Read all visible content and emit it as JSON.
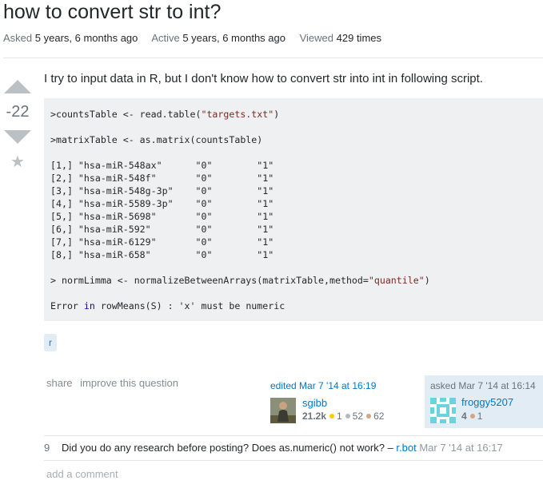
{
  "question": {
    "title": "how to convert str to int?",
    "meta": {
      "asked_label": "Asked",
      "asked_value": "5 years, 6 months ago",
      "active_label": "Active",
      "active_value": "5 years, 6 months ago",
      "viewed_label": "Viewed",
      "viewed_value": "429 times"
    },
    "score": "-22",
    "body_text": "I try to input data in R, but I don't know how to convert str into int in following script.",
    "code": {
      "line1_prefix": ">countsTable <- read.table(",
      "line1_str": "\"targets.txt\"",
      "line1_suffix": ")",
      "line2": ">matrixTable <- as.matrix(countsTable)",
      "rows": [
        "[1,] \"hsa-miR-548ax\"      \"0\"        \"1\"",
        "[2,] \"hsa-miR-548f\"       \"0\"        \"1\"",
        "[3,] \"hsa-miR-548g-3p\"    \"0\"        \"1\"",
        "[4,] \"hsa-miR-5589-3p\"    \"0\"        \"1\"",
        "[5,] \"hsa-miR-5698\"       \"0\"        \"1\"",
        "[6,] \"hsa-miR-592\"        \"0\"        \"1\"",
        "[7,] \"hsa-miR-6129\"       \"0\"        \"1\"",
        "[8,] \"hsa-miR-658\"        \"0\"        \"1\""
      ],
      "line3_prefix": "> normLimma <- normalizeBetweenArrays(matrixTable,method=",
      "line3_str": "\"quantile\"",
      "line3_suffix": ")",
      "line4_a": "Error ",
      "line4_kw": "in",
      "line4_b": " rowMeans(S) : 'x' must be numeric"
    },
    "tags": [
      "r"
    ],
    "menu": {
      "share": "share",
      "improve": "improve this question"
    },
    "editor": {
      "when": "edited Mar 7 '14 at 16:19",
      "name": "sgibb",
      "rep": "21.2k",
      "gold": "1",
      "silver": "52",
      "bronze": "62"
    },
    "asker": {
      "when": "asked Mar 7 '14 at 16:14",
      "name": "froggy5207",
      "rep": "4",
      "bronze": "1"
    },
    "comment": {
      "score": "9",
      "text": "Did you do any research before posting? Does as.numeric() not work? – ",
      "user": "r.bot",
      "date": "Mar 7 '14 at 16:17"
    },
    "add_comment": "add a comment"
  },
  "colors": {
    "link": "#0077cc",
    "tag_bg": "#e1ecf4",
    "tag_fg": "#39739d",
    "code_bg": "#eff0f1",
    "gold": "#ffcc01",
    "silver": "#b4b8bc",
    "bronze": "#d1a684"
  }
}
